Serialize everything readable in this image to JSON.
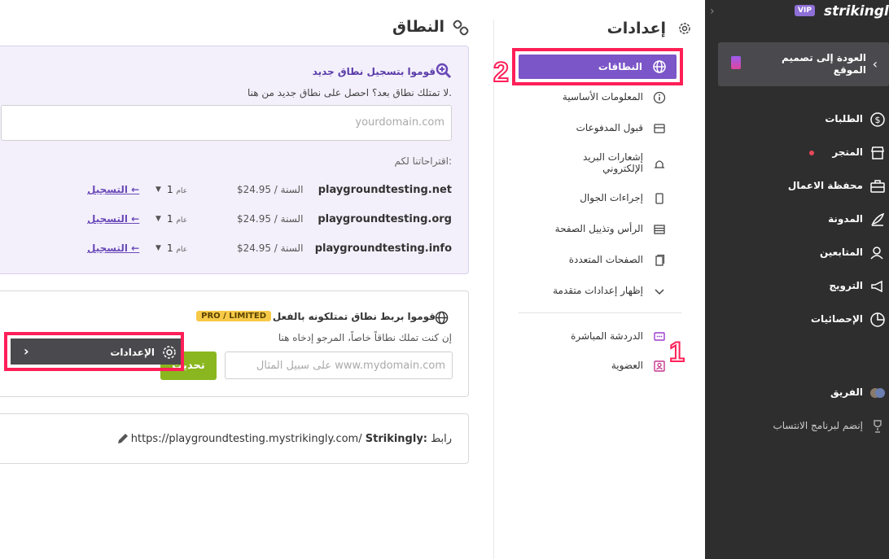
{
  "sidebar": {
    "brand": "strikingly",
    "vip_badge": "VIP",
    "back_label": "العودة إلى تصميم الموقع",
    "items": [
      {
        "label": "الطلبات",
        "icon": "dollar-circle-icon"
      },
      {
        "label": "المتجر",
        "icon": "store-icon"
      },
      {
        "label": "محفظة الاعمال",
        "icon": "briefcase-icon"
      },
      {
        "label": "المدونة",
        "icon": "feather-icon"
      },
      {
        "label": "المتابعين",
        "icon": "users-icon"
      },
      {
        "label": "الترويج",
        "icon": "megaphone-icon"
      },
      {
        "label": "الإحصائيات",
        "icon": "pie-chart-icon"
      }
    ],
    "active_label": "الإعدادات",
    "team_label": "الفريق",
    "affiliate_label": "إنضم لبرنامج الانتساب"
  },
  "annotations": {
    "one": "1",
    "two": "2"
  },
  "settings_nav": {
    "title": "إعدادات",
    "active_label": "النطاقات",
    "items": [
      {
        "label": "المعلومات الأساسية"
      },
      {
        "label": "قبول المدفوعات"
      },
      {
        "label": "إشعارات البريد الإلكتروني"
      },
      {
        "label": "إجراءات الجوال"
      },
      {
        "label": "الرأس وتذييل الصفحة"
      },
      {
        "label": "الصفحات المتعددة"
      },
      {
        "label": "إظهار إعدادات متقدمة"
      }
    ],
    "extra": [
      {
        "label": "الدردشة المباشرة"
      },
      {
        "label": "العضوية"
      }
    ]
  },
  "main": {
    "title": "النطاق",
    "register": {
      "title": "قوموا بتسجيل نطاق جديد",
      "subtitle": "لا تمتلك نطاق بعد؟ احصل على نطاق جديد من هنا.",
      "placeholder": "yourdomain.com",
      "suggestions_label": "اقتراحاتنا لكم:",
      "domains": [
        {
          "name": "playgroundtesting.net",
          "price": "$24.95 / السنة",
          "years": "1",
          "unit": "عام",
          "action": "التسجيل ←"
        },
        {
          "name": "playgroundtesting.org",
          "price": "$24.95 / السنة",
          "years": "1",
          "unit": "عام",
          "action": "التسجيل ←"
        },
        {
          "name": "playgroundtesting.info",
          "price": "$24.95 / السنة",
          "years": "1",
          "unit": "عام",
          "action": "التسجيل ←"
        }
      ]
    },
    "connect": {
      "title": "قوموا بربط نطاق تمتلكونه بالفعل",
      "badge": "PRO / LIMITED",
      "subtitle": "إن كنت تملك نطاقاً خاصاً، المرجو إدخاه هنا",
      "placeholder": "على سبيل المثال www.mydomain.com",
      "button": "تحديث"
    },
    "url": {
      "prefix": "رابط",
      "brand": "Strikingly:",
      "value": "https://playgroundtesting.mystrikingly.com/"
    }
  }
}
